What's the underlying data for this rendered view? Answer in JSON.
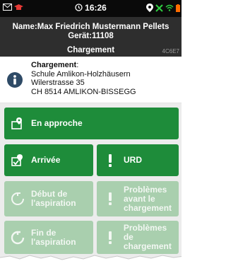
{
  "status_bar": {
    "time": "16:26"
  },
  "header": {
    "name_line": "Name:Max Friedrich Mustermann Pellets",
    "device_line": "Gerät:11108",
    "section_title": "Chargement",
    "code": "4C6E7"
  },
  "info": {
    "label": "Chargement",
    "label_suffix": ":",
    "line1": "Schule Amlikon-Holzhäusern",
    "line2": "Wilerstrasse 35",
    "line3": "CH 8514 AMLIKON-BISSEGG"
  },
  "buttons": {
    "approach": "En approche",
    "arrival": "Arrivée",
    "urd": "URD",
    "suction_start_1": "Début de",
    "suction_start_2": "l'aspiration",
    "problems_before_1": "Problèmes",
    "problems_before_2": "avant le",
    "problems_before_3": "chargement",
    "suction_end_1": "Fin de",
    "suction_end_2": "l'aspiration",
    "problems_load_1": "Problèmes de",
    "problems_load_2": "chargement"
  },
  "colors": {
    "active_green": "#1e8c3a",
    "disabled_green": "#a9cfae",
    "header_bg": "#2e2e2e",
    "statusbar_bg": "#0a0a0a"
  }
}
